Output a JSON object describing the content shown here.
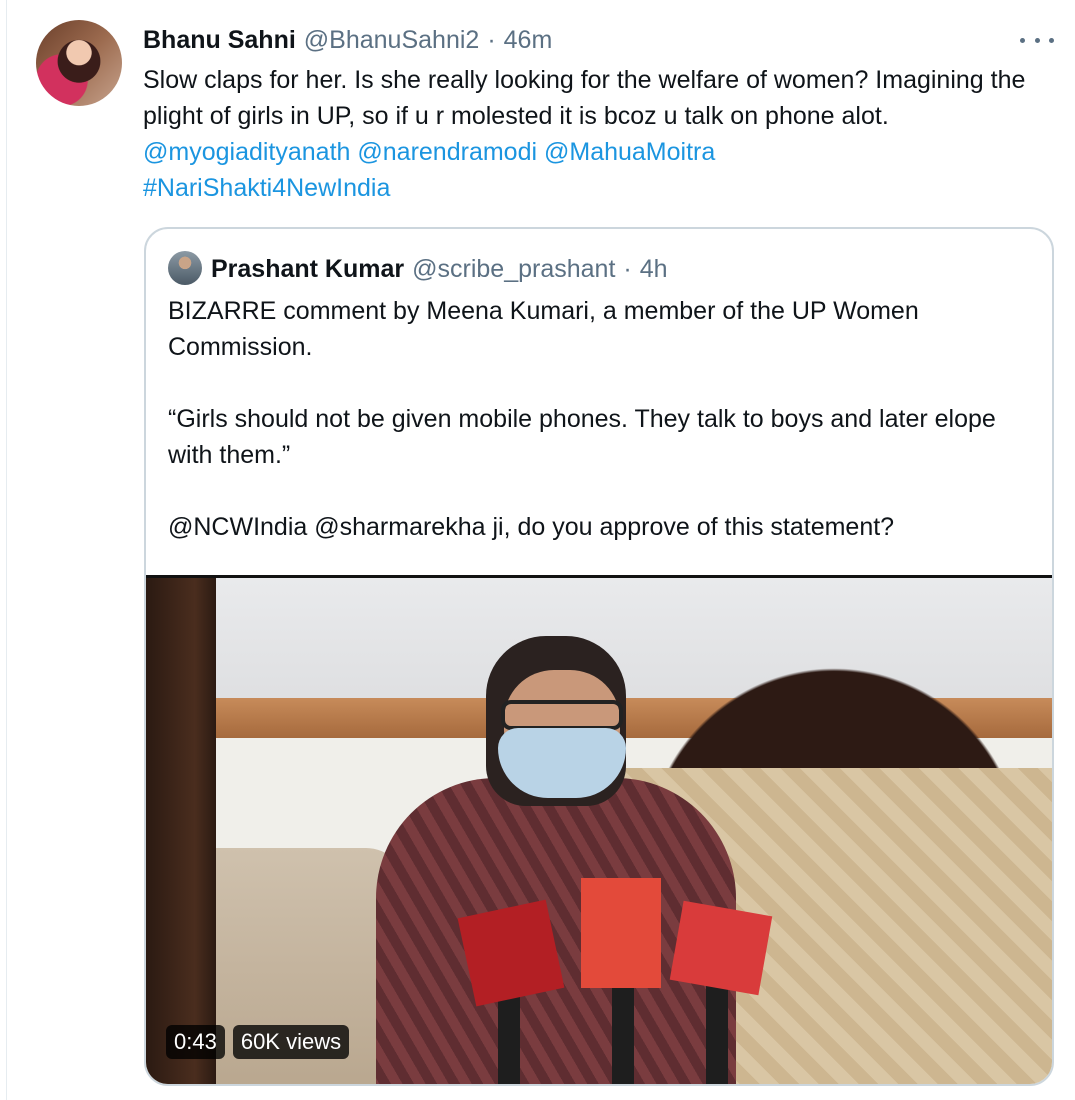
{
  "tweet": {
    "display_name": "Bhanu Sahni",
    "handle": "@BhanuSahni2",
    "separator": "·",
    "time": "46m",
    "text_plain": "Slow claps for her. Is she really looking for the welfare of women? Imagining the plight of girls in UP, so if u r molested it is bcoz u talk on phone alot.",
    "mentions": [
      "@myogiadityanath",
      "@narendramodi",
      "@MahuaMoitra"
    ],
    "hashtag": "#NariShakti4NewIndia",
    "more_icon": "more-horizontal-icon"
  },
  "quoted": {
    "display_name": "Prashant Kumar",
    "handle": "@scribe_prashant",
    "separator": "·",
    "time": "4h",
    "paragraphs": [
      "BIZARRE comment by Meena Kumari, a member of the UP Women Commission.",
      "“Girls should not be given mobile phones. They talk to boys and later elope with them.”",
      "@NCWIndia @sharmarekha ji, do you approve of this statement?"
    ],
    "video": {
      "duration": "0:43",
      "views": "60K views"
    }
  },
  "colors": {
    "link": "#1b95e0",
    "secondary_text": "#5b7083",
    "border": "#ccd6dd"
  }
}
